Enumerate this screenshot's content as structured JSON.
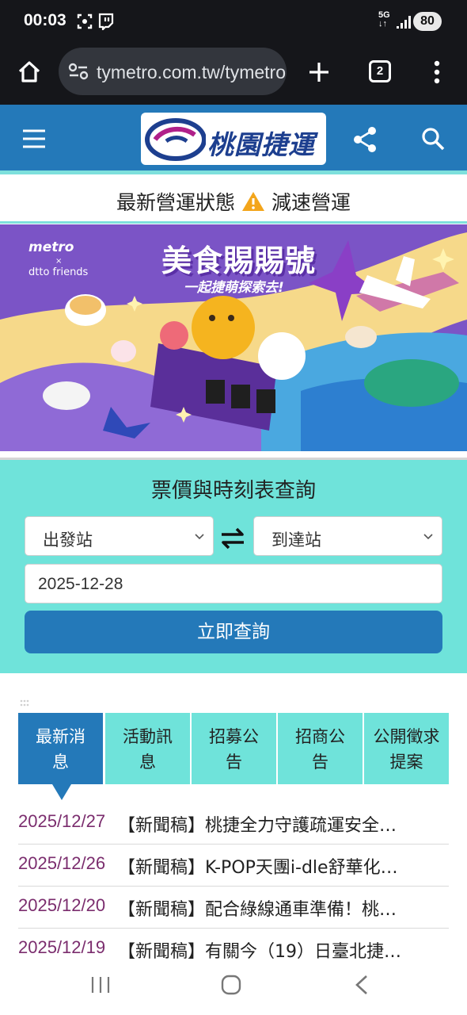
{
  "status_bar": {
    "time": "00:03",
    "network": "5G",
    "battery": "80"
  },
  "browser": {
    "url": "tymetro.com.tw/tymetro",
    "tab_count": "2"
  },
  "site": {
    "logo_text": "桃園捷運",
    "brand_color": "#2479b9",
    "accent_color": "#6fe3da"
  },
  "operation_status": {
    "label": "最新營運狀態",
    "value": "減速營運"
  },
  "banner": {
    "title": "美食賜賜號",
    "subtitle": "一起捷萌探索去!",
    "metro_logo": "metro",
    "collab_x": "×",
    "partner": "dtto friends"
  },
  "query": {
    "title": "票價與時刻表查詢",
    "from_placeholder": "出發站",
    "to_placeholder": "到達站",
    "date": "2025-12-28",
    "submit_label": "立即查詢"
  },
  "news_tabs": [
    {
      "label": "最新消息"
    },
    {
      "label": "活動訊息"
    },
    {
      "label": "招募公告"
    },
    {
      "label": "招商公告"
    },
    {
      "label": "公開徵求提案"
    }
  ],
  "news": [
    {
      "date": "2025/12/27",
      "title": "【新聞稿】桃捷全力守護疏運安全…"
    },
    {
      "date": "2025/12/26",
      "title": "【新聞稿】K-POP天團i-dle舒華化…"
    },
    {
      "date": "2025/12/20",
      "title": "【新聞稿】配合綠線通車準備！桃…"
    },
    {
      "date": "2025/12/19",
      "title": "【新聞稿】有關今（19）日臺北捷…"
    }
  ]
}
